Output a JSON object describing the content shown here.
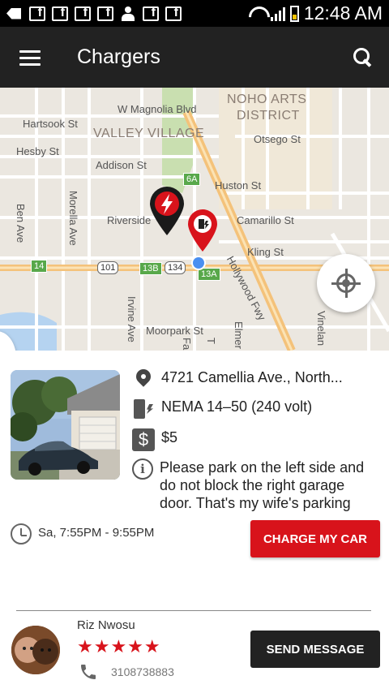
{
  "status_bar": {
    "time": "12:48 AM"
  },
  "app_bar": {
    "title": "Chargers"
  },
  "map": {
    "labels": {
      "w_magnolia": "W Magnolia Blvd",
      "noho_1": "NOHO ARTS",
      "noho_2": "DISTRICT",
      "hartsook": "Hartsook St",
      "valley_village": "VALLEY VILLAGE",
      "otsego": "Otsego St",
      "hesby": "Hesby St",
      "addison": "Addison St",
      "huston": "Huston St",
      "ben_ave": "Ben Ave",
      "morella": "Morella Ave",
      "riverside": "Riverside",
      "camarillo": "Camarillo St",
      "kling": "Kling St",
      "hollywood_fwy": "Hollywood Fwy",
      "irvine": "Irvine Ave",
      "moorpark": "Moorpark St",
      "elmer": "Elmer",
      "vineland": "Vinelan",
      "fa": "Fa",
      "t": "T"
    },
    "shields": {
      "s6a": "6A",
      "s14": "14",
      "s101": "101",
      "s13b": "13B",
      "s134": "134",
      "s13a": "13A"
    }
  },
  "listing": {
    "address": "4721 Camellia Ave., North...",
    "plug": "NEMA 14–50 (240 volt)",
    "dollar_symbol": "$",
    "price": "$5",
    "info_symbol": "i",
    "note": "Please park on the left side and do not block the right garage door. That's my wife's parking",
    "time": "Sa, 7:55PM - 9:55PM",
    "charge_button": "CHARGE MY CAR"
  },
  "host": {
    "name": "Riz Nwosu",
    "stars": "★★★★★",
    "rating": 5,
    "phone": "3108738883",
    "message_button": "SEND MESSAGE"
  },
  "colors": {
    "accent": "#d8131b",
    "appbar": "#222222"
  }
}
